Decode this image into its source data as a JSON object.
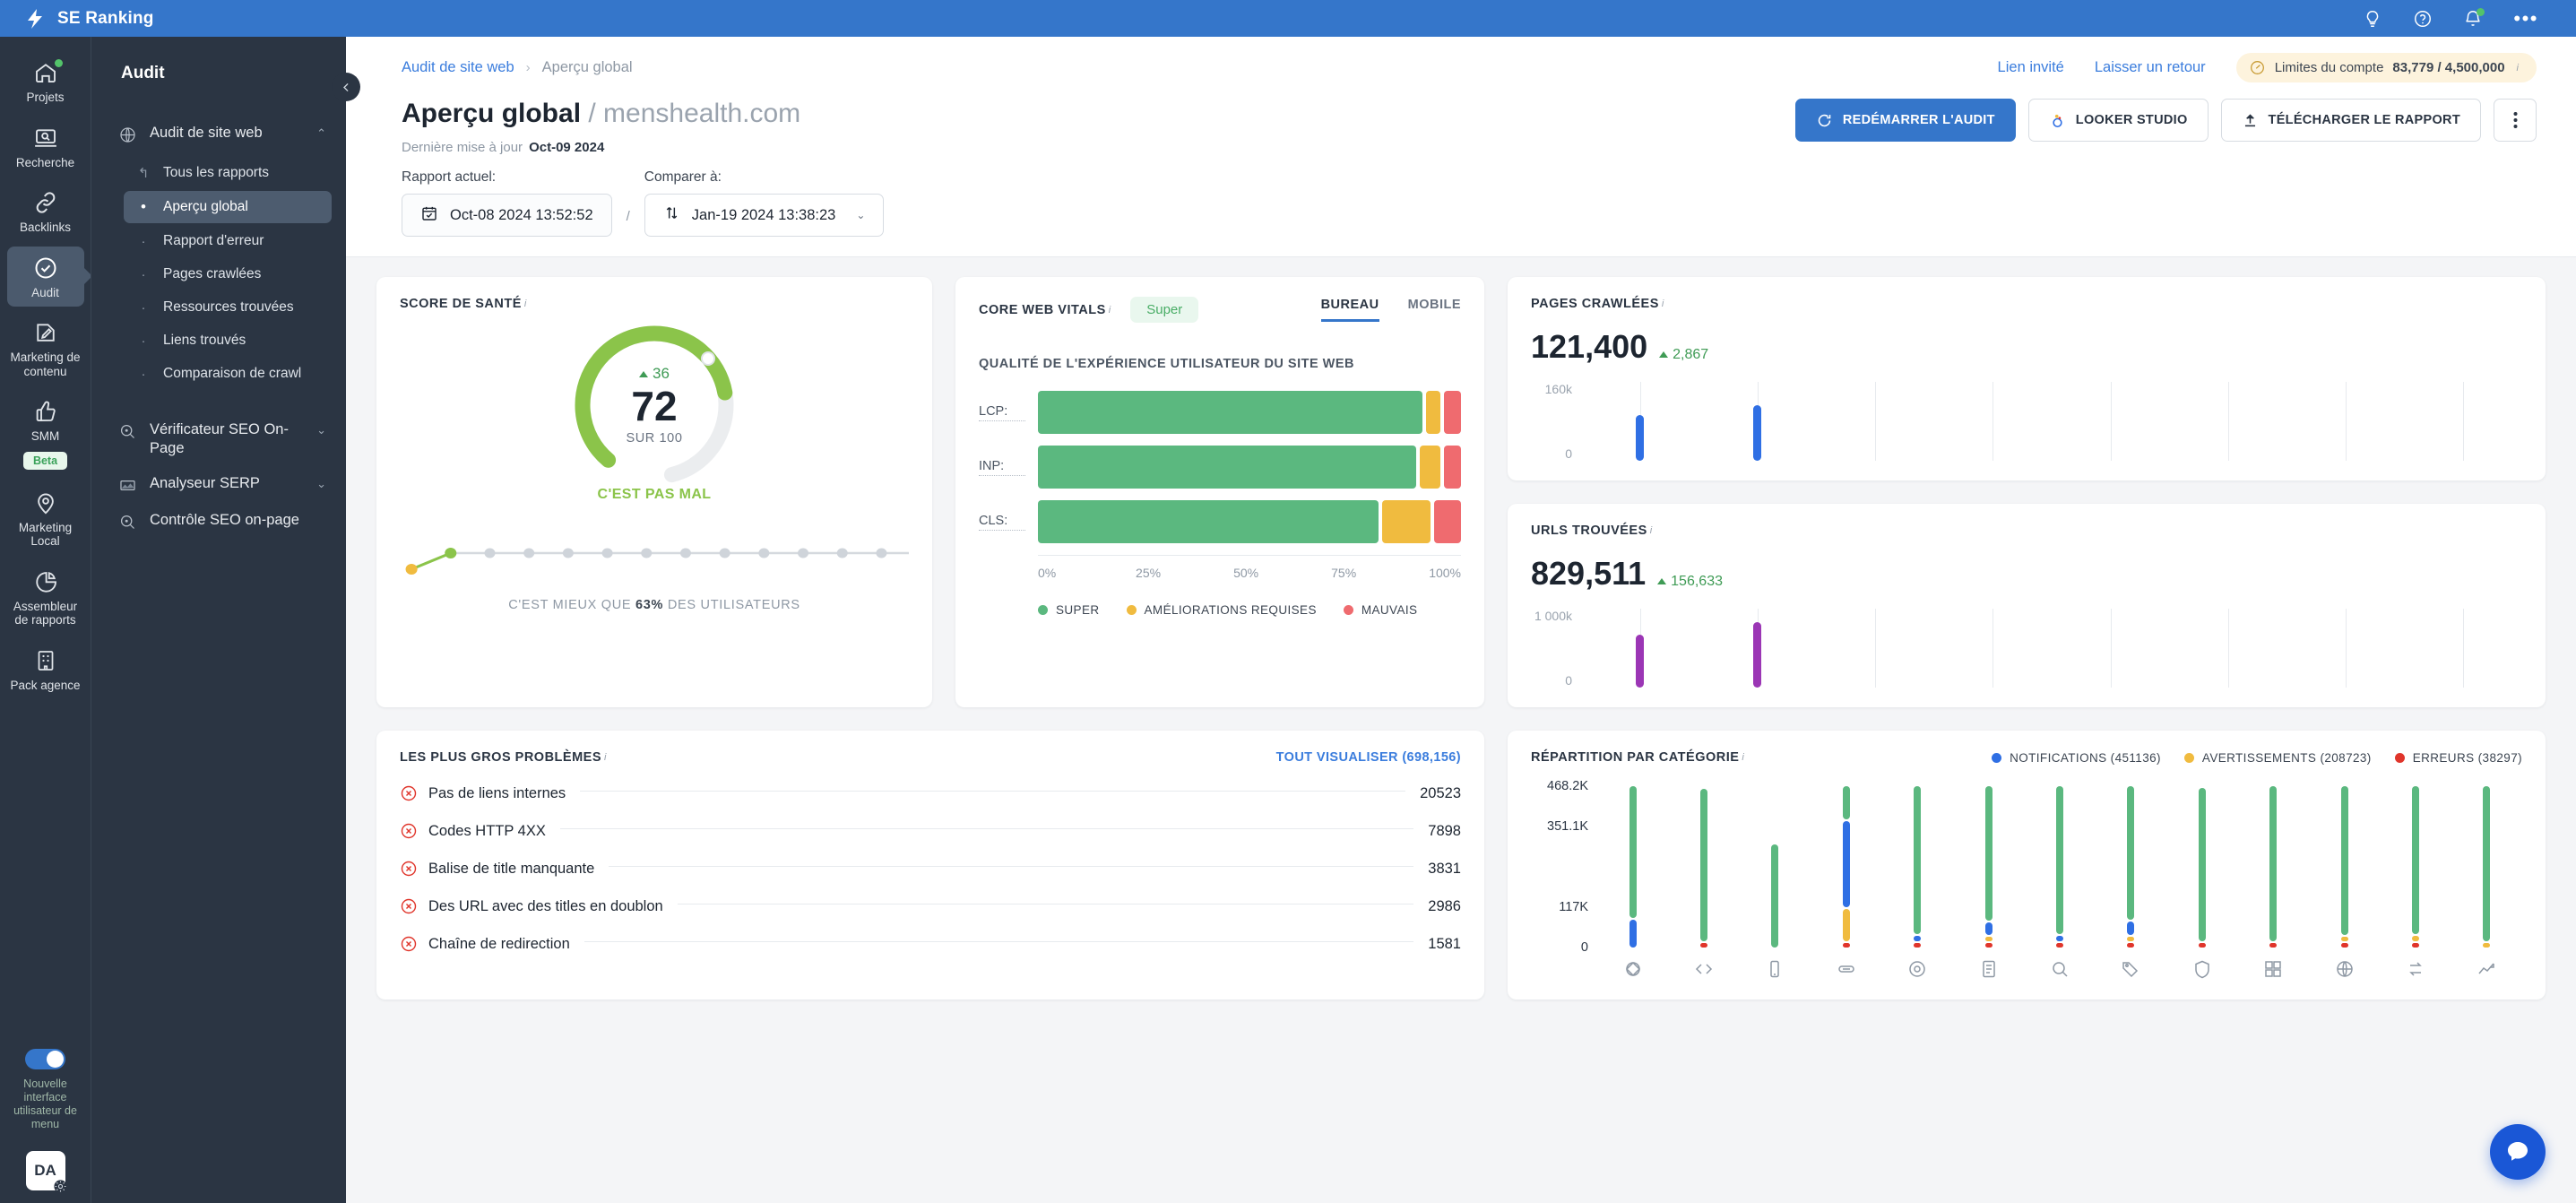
{
  "topbar": {
    "brand": "SE Ranking",
    "icons": [
      "lightbulb-icon",
      "help-icon",
      "notifications-icon",
      "more-icon"
    ]
  },
  "rail": {
    "items": [
      {
        "label": "Projets",
        "icon": "home-icon",
        "dot": true,
        "active": false
      },
      {
        "label": "Recherche",
        "icon": "research-icon",
        "dot": false,
        "active": false
      },
      {
        "label": "Backlinks",
        "icon": "link-icon",
        "dot": false,
        "active": false
      },
      {
        "label": "Audit",
        "icon": "audit-check-icon",
        "dot": false,
        "active": true
      },
      {
        "label": "Marketing de contenu",
        "icon": "content-edit-icon",
        "dot": false,
        "active": false
      },
      {
        "label": "SMM",
        "icon": "thumbs-up-icon",
        "dot": false,
        "active": false,
        "badge": "Beta"
      },
      {
        "label": "Marketing Local",
        "icon": "map-pin-icon",
        "dot": false,
        "active": false
      },
      {
        "label": "Assembleur de rapports",
        "icon": "report-pie-icon",
        "dot": false,
        "active": false
      },
      {
        "label": "Pack agence",
        "icon": "agency-building-icon",
        "dot": false,
        "active": false
      }
    ],
    "toggle_label": "Nouvelle interface utilisateur de menu",
    "avatar_initials": "DA"
  },
  "subnav": {
    "title": "Audit",
    "group_label": "Audit de site web",
    "items": [
      {
        "label": "Tous les rapports",
        "active": false,
        "bullet": "return"
      },
      {
        "label": "Aperçu global",
        "active": true,
        "bullet": "dot"
      },
      {
        "label": "Rapport d'erreur",
        "active": false,
        "bullet": "dot"
      },
      {
        "label": "Pages crawlées",
        "active": false,
        "bullet": "dot"
      },
      {
        "label": "Ressources trouvées",
        "active": false,
        "bullet": "dot"
      },
      {
        "label": "Liens trouvés",
        "active": false,
        "bullet": "dot"
      },
      {
        "label": "Comparaison de crawl",
        "active": false,
        "bullet": "dot"
      }
    ],
    "other_groups": [
      {
        "label": "Vérificateur SEO On-Page",
        "icon": "magnifier-dot-icon"
      },
      {
        "label": "Analyseur SERP",
        "icon": "serp-chart-icon"
      },
      {
        "label": "Contrôle SEO on-page",
        "icon": "magnifier-dot-icon"
      }
    ]
  },
  "breadcrumb": {
    "parent": "Audit de site web",
    "separator": "›",
    "current": "Aperçu global",
    "guest_link": "Lien invité",
    "feedback_link": "Laisser un retour",
    "limits_label": "Limites du compte",
    "limits_value": "83,779 / 4,500,000"
  },
  "header": {
    "title": "Aperçu global",
    "domain": "/ menshealth.com",
    "updated_label": "Dernière mise à jour",
    "updated_value": "Oct-09 2024",
    "restart_button": "REDÉMARRER L'AUDIT",
    "looker_button": "LOOKER STUDIO",
    "download_button": "TÉLÉCHARGER LE RAPPORT",
    "more_button": "⋮"
  },
  "daterow": {
    "current_label": "Rapport actuel:",
    "current_value": "Oct-08 2024 13:52:52",
    "slash": "/",
    "compare_label": "Comparer à:",
    "compare_value": "Jan-19 2024 13:38:23"
  },
  "chart_data": [
    {
      "type": "bar",
      "title": "PAGES CRAWLÉES",
      "stat_value": "121,400",
      "delta": "2,867",
      "categories": [
        "1",
        "2",
        "3",
        "4",
        "5",
        "6",
        "7",
        "8"
      ],
      "values": [
        93000,
        112000,
        0,
        0,
        0,
        0,
        0,
        0
      ],
      "ylim": [
        0,
        160000
      ],
      "ytick_labels": [
        "160k",
        "0"
      ],
      "color": "#2f6fe4",
      "xlabel": "",
      "ylabel": "",
      "grid": true
    },
    {
      "type": "bar",
      "title": "URLS TROUVÉES",
      "stat_value": "829,511",
      "delta": "156,633",
      "categories": [
        "1",
        "2",
        "3",
        "4",
        "5",
        "6",
        "7",
        "8"
      ],
      "values": [
        672000,
        829511,
        0,
        0,
        0,
        0,
        0,
        0
      ],
      "ylim": [
        0,
        1000000
      ],
      "ytick_labels": [
        "1 000k",
        "0"
      ],
      "color": "#9b36b5",
      "xlabel": "",
      "ylabel": "",
      "grid": true
    },
    {
      "type": "gauge",
      "title": "SCORE DE SANTÉ",
      "score": "72",
      "out_of": "SUR 100",
      "delta": "36",
      "caption": "C'EST PAS MAL",
      "percent": 72,
      "color": "#8bc44a",
      "track_color": "#ebedef",
      "sparkline": [
        5,
        42,
        42,
        42,
        42,
        42,
        42,
        42,
        42,
        42,
        42,
        42,
        42
      ],
      "footer_prefix": "C'EST MIEUX QUE",
      "footer_value": "63%",
      "footer_suffix": "DES UTILISATEURS"
    },
    {
      "type": "bar",
      "title": "CORE WEB VITALS",
      "badge": "Super",
      "subtitle": "QUALITÉ DE L'EXPÉRIENCE UTILISATEUR DU SITE WEB",
      "tabs": [
        "BUREAU",
        "MOBILE"
      ],
      "active_tab": "BUREAU",
      "categories": [
        "LCP:",
        "INP:",
        "CLS:"
      ],
      "series": [
        {
          "name": "SUPER",
          "color": "#5bb87f",
          "values": [
            92.5,
            91.0,
            82.0
          ]
        },
        {
          "name": "AMÉLIORATIONS REQUISES",
          "color": "#f0bb3f",
          "values": [
            3.5,
            5.0,
            11.5
          ]
        },
        {
          "name": "MAUVAIS",
          "color": "#ef6b6f",
          "values": [
            4.0,
            4.0,
            6.5
          ]
        }
      ],
      "xticks": [
        "0%",
        "25%",
        "50%",
        "75%",
        "100%"
      ],
      "xlim": [
        0,
        100
      ],
      "legend": [
        "SUPER",
        "AMÉLIORATIONS REQUISES",
        "MAUVAIS"
      ]
    },
    {
      "type": "bar",
      "title": "RÉPARTITION PAR CATÉGORIE",
      "legend": [
        {
          "name": "NOTIFICATIONS (451136)",
          "color": "#2f6fe4"
        },
        {
          "name": "AVERTISSEMENTS (208723)",
          "color": "#f0bb3f"
        },
        {
          "name": "ERREURS (38297)",
          "color": "#e0352b"
        }
      ],
      "ytick_labels": [
        "468.2K",
        "351.1K",
        "117K",
        "0"
      ],
      "ylim": [
        0,
        468200
      ],
      "categories": [
        "security",
        "code",
        "mobile",
        "links",
        "speed",
        "content",
        "indexing",
        "tags",
        "https",
        "structure",
        "localization",
        "redirects",
        "traffic"
      ],
      "series": [
        {
          "name": "green",
          "color": "#5bb87f",
          "values": [
            385000,
            440000,
            300000,
            110000,
            440000,
            420000,
            440000,
            430000,
            445000,
            450000,
            445000,
            440000,
            450000
          ]
        },
        {
          "name": "notifications",
          "color": "#2f6fe4",
          "values": [
            80000,
            0,
            0,
            290000,
            14000,
            38000,
            16000,
            44000,
            0,
            0,
            0,
            0,
            0
          ]
        },
        {
          "name": "avertissements",
          "color": "#f0bb3f",
          "values": [
            0,
            0,
            0,
            110000,
            0,
            11000,
            0,
            11000,
            0,
            0,
            10000,
            10000,
            7000
          ]
        },
        {
          "name": "erreurs",
          "color": "#e0352b",
          "values": [
            0,
            9000,
            0,
            9000,
            9000,
            9000,
            9000,
            9000,
            9000,
            9000,
            9000,
            9000,
            0
          ]
        }
      ]
    }
  ],
  "issues": {
    "title": "LES PLUS GROS PROBLÈMES",
    "view_all": "TOUT VISUALISER (698,156)",
    "rows": [
      {
        "name": "Pas de liens internes",
        "value": "20523"
      },
      {
        "name": "Codes HTTP 4XX",
        "value": "7898"
      },
      {
        "name": "Balise de title manquante",
        "value": "3831"
      },
      {
        "name": "Des URL avec des titles en doublon",
        "value": "2986"
      },
      {
        "name": "Chaîne de redirection",
        "value": "1581"
      }
    ]
  },
  "colors": {
    "brand_blue": "#3576ca",
    "dark_nav": "#2b3543",
    "green": "#5bb87f",
    "amber": "#f0bb3f",
    "red": "#ef6b6f",
    "score_green": "#8bc44a",
    "purple": "#9b36b5"
  }
}
